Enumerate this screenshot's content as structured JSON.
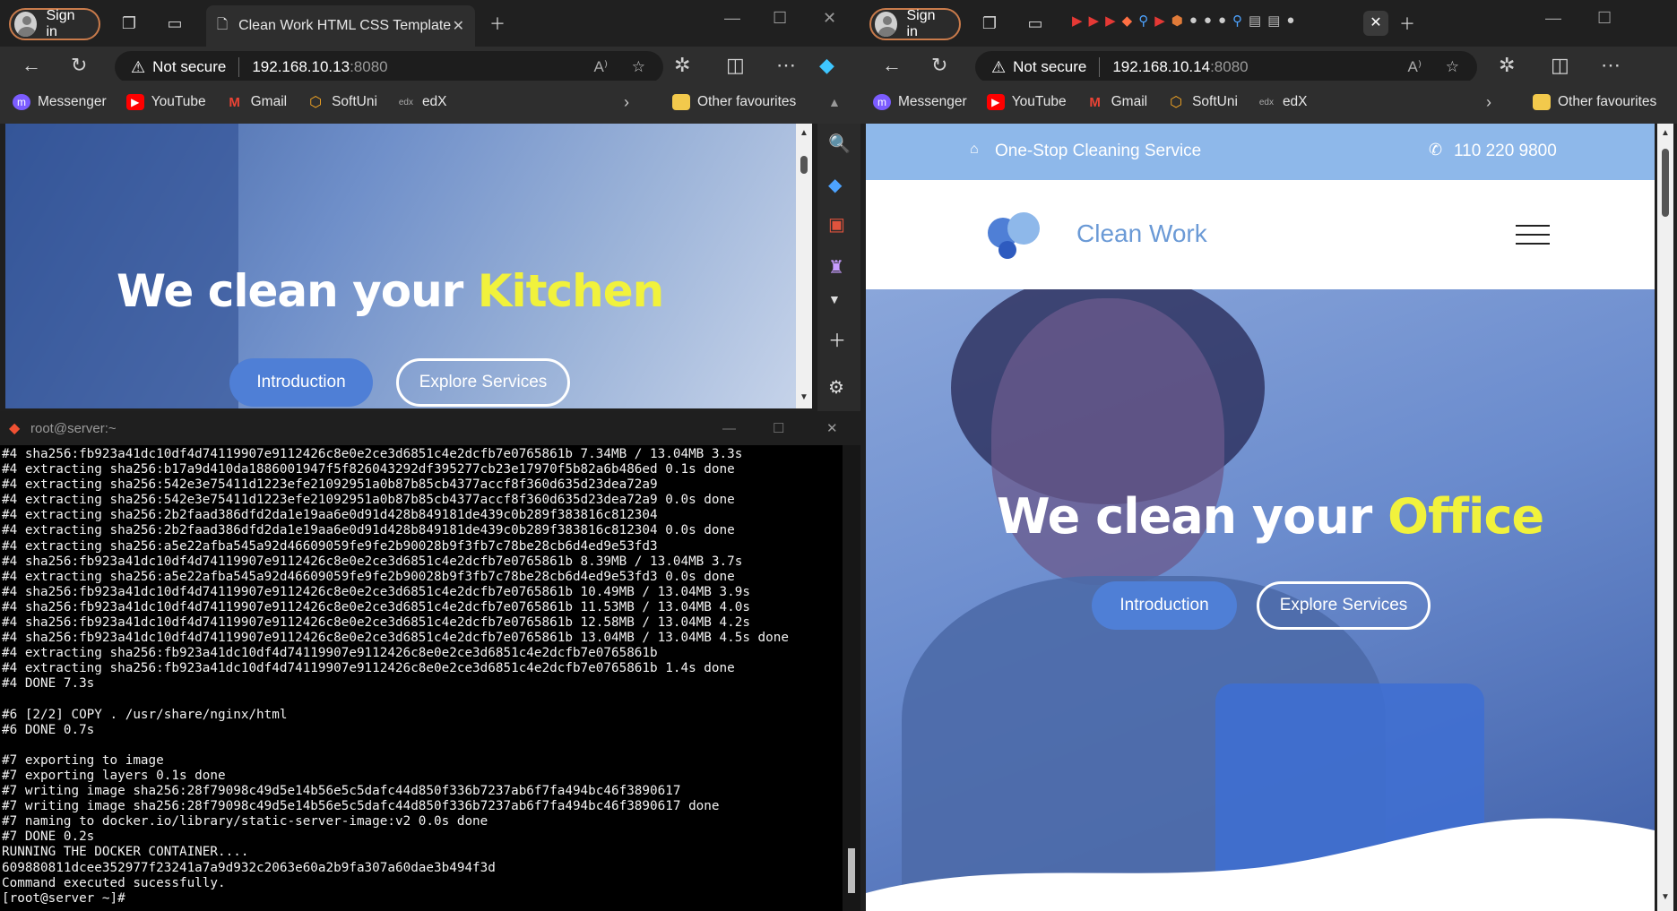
{
  "left_browser": {
    "sign_in": "Sign in",
    "tab_title": "Clean Work HTML CSS Template",
    "security": "Not secure",
    "address_host": "192.168.10.13",
    "address_port": ":8080",
    "favourites": [
      "Messenger",
      "YouTube",
      "Gmail",
      "SoftUni",
      "edX"
    ],
    "other_favourites": "Other favourites",
    "hero_prefix": "We clean your ",
    "hero_highlight": "Kitchen",
    "btn_intro": "Introduction",
    "btn_explore": "Explore Services"
  },
  "terminal": {
    "title": "root@server:~",
    "lines": [
      "#4 sha256:fb923a41dc10df4d74119907e9112426c8e0e2ce3d6851c4e2dcfb7e0765861b 7.34MB / 13.04MB 3.3s",
      "#4 extracting sha256:b17a9d410da1886001947f5f826043292df395277cb23e17970f5b82a6b486ed 0.1s done",
      "#4 extracting sha256:542e3e75411d1223efe21092951a0b87b85cb4377accf8f360d635d23dea72a9",
      "#4 extracting sha256:542e3e75411d1223efe21092951a0b87b85cb4377accf8f360d635d23dea72a9 0.0s done",
      "#4 extracting sha256:2b2faad386dfd2da1e19aa6e0d91d428b849181de439c0b289f383816c812304",
      "#4 extracting sha256:2b2faad386dfd2da1e19aa6e0d91d428b849181de439c0b289f383816c812304 0.0s done",
      "#4 extracting sha256:a5e22afba545a92d46609059fe9fe2b90028b9f3fb7c78be28cb6d4ed9e53fd3",
      "#4 sha256:fb923a41dc10df4d74119907e9112426c8e0e2ce3d6851c4e2dcfb7e0765861b 8.39MB / 13.04MB 3.7s",
      "#4 extracting sha256:a5e22afba545a92d46609059fe9fe2b90028b9f3fb7c78be28cb6d4ed9e53fd3 0.0s done",
      "#4 sha256:fb923a41dc10df4d74119907e9112426c8e0e2ce3d6851c4e2dcfb7e0765861b 10.49MB / 13.04MB 3.9s",
      "#4 sha256:fb923a41dc10df4d74119907e9112426c8e0e2ce3d6851c4e2dcfb7e0765861b 11.53MB / 13.04MB 4.0s",
      "#4 sha256:fb923a41dc10df4d74119907e9112426c8e0e2ce3d6851c4e2dcfb7e0765861b 12.58MB / 13.04MB 4.2s",
      "#4 sha256:fb923a41dc10df4d74119907e9112426c8e0e2ce3d6851c4e2dcfb7e0765861b 13.04MB / 13.04MB 4.5s done",
      "#4 extracting sha256:fb923a41dc10df4d74119907e9112426c8e0e2ce3d6851c4e2dcfb7e0765861b",
      "#4 extracting sha256:fb923a41dc10df4d74119907e9112426c8e0e2ce3d6851c4e2dcfb7e0765861b 1.4s done",
      "#4 DONE 7.3s",
      "",
      "#6 [2/2] COPY . /usr/share/nginx/html",
      "#6 DONE 0.7s",
      "",
      "#7 exporting to image",
      "#7 exporting layers 0.1s done",
      "#7 writing image sha256:28f79098c49d5e14b56e5c5dafc44d850f336b7237ab6f7fa494bc46f3890617",
      "#7 writing image sha256:28f79098c49d5e14b56e5c5dafc44d850f336b7237ab6f7fa494bc46f3890617 done",
      "#7 naming to docker.io/library/static-server-image:v2 0.0s done",
      "#7 DONE 0.2s",
      "RUNNING THE DOCKER CONTAINER....",
      "609880811dcee352977f23241a7a9d932c2063e60a2b9fa307a60dae3b494f3d",
      "Command executed sucessfully.",
      "[root@server ~]# "
    ]
  },
  "right_browser": {
    "sign_in": "Sign in",
    "security": "Not secure",
    "address_host": "192.168.10.14",
    "address_port": ":8080",
    "favourites": [
      "Messenger",
      "YouTube",
      "Gmail",
      "SoftUni",
      "edX"
    ],
    "other_favourites": "Other favourites",
    "topbar_service": "One-Stop Cleaning Service",
    "topbar_phone": "110 220 9800",
    "brand": "Clean Work",
    "hero_prefix": "We clean your ",
    "hero_highlight": "Office",
    "btn_intro": "Introduction",
    "btn_explore": "Explore Services"
  }
}
